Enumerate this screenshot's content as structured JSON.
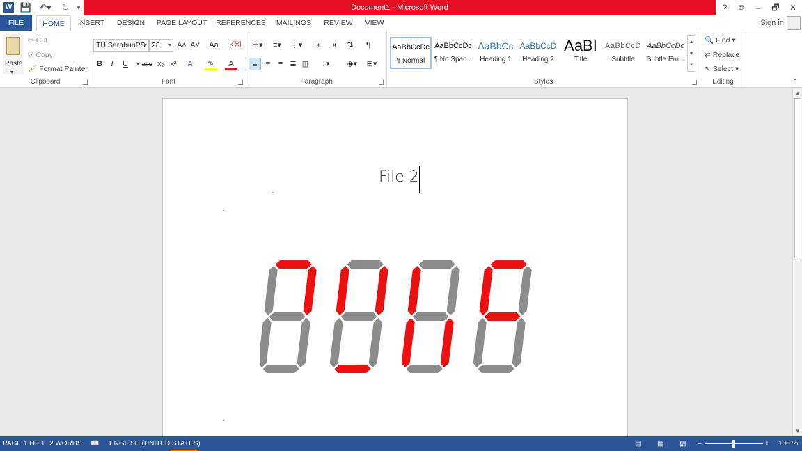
{
  "titlebar": {
    "app_icon": "W",
    "title": "Document1 - Microsoft Word",
    "help": "?",
    "ribbon_display": "⧉",
    "minimize": "–",
    "restore": "🗗",
    "close": "✕"
  },
  "tabs": [
    {
      "label": "FILE"
    },
    {
      "label": "HOME"
    },
    {
      "label": "INSERT"
    },
    {
      "label": "DESIGN"
    },
    {
      "label": "PAGE LAYOUT"
    },
    {
      "label": "REFERENCES"
    },
    {
      "label": "MAILINGS"
    },
    {
      "label": "REVIEW"
    },
    {
      "label": "VIEW"
    }
  ],
  "signin": "Sign in",
  "clipboard": {
    "paste": "Paste",
    "cut": "Cut",
    "copy": "Copy",
    "format_painter": "Format Painter",
    "label": "Clipboard"
  },
  "font": {
    "family": "TH SarabunPS",
    "size": "28",
    "label": "Font",
    "grow": "A˄",
    "shrink": "A˅",
    "case": "Aa",
    "bold": "B",
    "italic": "I",
    "underline": "U",
    "strike": "abc",
    "subscript": "x₂",
    "superscript": "x²"
  },
  "paragraph": {
    "label": "Paragraph",
    "pilcrow": "¶"
  },
  "styles": {
    "label": "Styles",
    "items": [
      {
        "preview": "AaBbCcDc",
        "name": "¶ Normal"
      },
      {
        "preview": "AaBbCcDc",
        "name": "¶ No Spac..."
      },
      {
        "preview": "AaBbCc",
        "name": "Heading 1"
      },
      {
        "preview": "AaBbCcD",
        "name": "Heading 2"
      },
      {
        "preview": "AaBI",
        "name": "Title"
      },
      {
        "preview": "AaBbCcD",
        "name": "Subtitle"
      },
      {
        "preview": "AaBbCcDc",
        "name": "Subtle Em..."
      }
    ]
  },
  "editing": {
    "find": "Find",
    "replace": "Replace",
    "select": "Select",
    "label": "Editing"
  },
  "document": {
    "text": "File 2"
  },
  "seven_segment": {
    "digits": [
      {
        "a": 1,
        "b": 1,
        "c": 0,
        "d": 0,
        "e": 0,
        "f": 0,
        "g": 0
      },
      {
        "a": 0,
        "b": 1,
        "c": 0,
        "d": 1,
        "e": 0,
        "f": 1,
        "g": 0
      },
      {
        "a": 0,
        "b": 0,
        "c": 1,
        "d": 0,
        "e": 1,
        "f": 1,
        "g": 0
      },
      {
        "a": 1,
        "b": 0,
        "c": 0,
        "d": 0,
        "e": 0,
        "f": 1,
        "g": 1
      }
    ],
    "on_color": "#ee1111",
    "off_color": "#8c8c8c"
  },
  "statusbar": {
    "page": "PAGE 1 OF 1",
    "words": "2 WORDS",
    "language": "ENGLISH (UNITED STATES)",
    "zoom": "100 %",
    "zoom_minus": "–",
    "zoom_plus": "+"
  },
  "colors": {
    "accent": "#2b579a",
    "title_band": "#e81123"
  }
}
